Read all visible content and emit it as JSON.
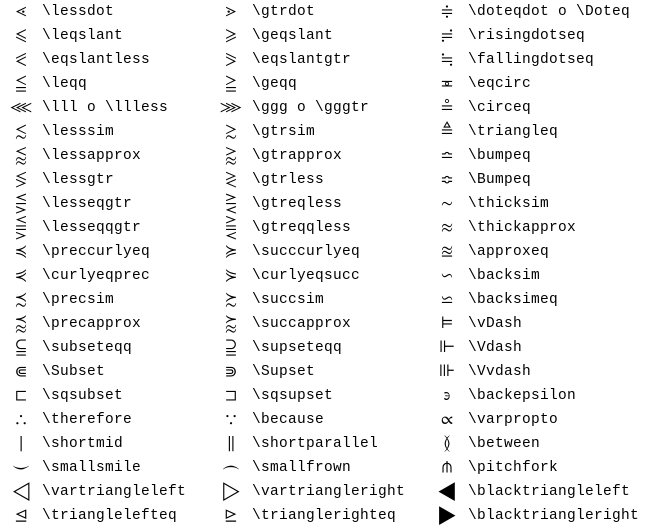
{
  "rows": [
    {
      "s1": "⋖",
      "c1": "\\lessdot",
      "s2": "⋗",
      "c2": "\\gtrdot",
      "s3": "≑",
      "c3": "\\doteqdot o \\Doteq"
    },
    {
      "s1": "⩽",
      "c1": "\\leqslant",
      "s2": "⩾",
      "c2": "\\geqslant",
      "s3": "≓",
      "c3": "\\risingdotseq"
    },
    {
      "s1": "⪕",
      "c1": "\\eqslantless",
      "s2": "⪖",
      "c2": "\\eqslantgtr",
      "s3": "≒",
      "c3": "\\fallingdotseq"
    },
    {
      "s1": "≦",
      "c1": "\\leqq",
      "s2": "≧",
      "c2": "\\geqq",
      "s3": "≖",
      "c3": "\\eqcirc"
    },
    {
      "s1": "⋘",
      "c1": "\\lll o \\llless",
      "s2": "⋙",
      "c2": "\\ggg o \\gggtr",
      "s3": "≗",
      "c3": "\\circeq"
    },
    {
      "s1": "≲",
      "c1": "\\lesssim",
      "s2": "≳",
      "c2": "\\gtrsim",
      "s3": "≜",
      "c3": "\\triangleq"
    },
    {
      "s1": "⪅",
      "c1": "\\lessapprox",
      "s2": "⪆",
      "c2": "\\gtrapprox",
      "s3": "≏",
      "c3": "\\bumpeq"
    },
    {
      "s1": "≶",
      "c1": "\\lessgtr",
      "s2": "≷",
      "c2": "\\gtrless",
      "s3": "≎",
      "c3": "\\Bumpeq"
    },
    {
      "s1": "⋚",
      "c1": "\\lesseqgtr",
      "s2": "⋛",
      "c2": "\\gtreqless",
      "s3": "∼",
      "c3": "\\thicksim"
    },
    {
      "s1": "⪋",
      "c1": "\\lesseqqgtr",
      "s2": "⪌",
      "c2": "\\gtreqqless",
      "s3": "≈",
      "c3": "\\thickapprox"
    },
    {
      "s1": "≼",
      "c1": "\\preccurlyeq",
      "s2": "≽",
      "c2": "\\succcurlyeq",
      "s3": "≊",
      "c3": "\\approxeq"
    },
    {
      "s1": "⋞",
      "c1": "\\curlyeqprec",
      "s2": "⋟",
      "c2": "\\curlyeqsucc",
      "s3": "∽",
      "c3": "\\backsim"
    },
    {
      "s1": "≾",
      "c1": "\\precsim",
      "s2": "≿",
      "c2": "\\succsim",
      "s3": "⋍",
      "c3": "\\backsimeq"
    },
    {
      "s1": "⪷",
      "c1": "\\precapprox",
      "s2": "⪸",
      "c2": "\\succapprox",
      "s3": "⊨",
      "c3": "\\vDash"
    },
    {
      "s1": "⫅",
      "c1": "\\subseteqq",
      "s2": "⫆",
      "c2": "\\supseteqq",
      "s3": "⊩",
      "c3": "\\Vdash"
    },
    {
      "s1": "⋐",
      "c1": "\\Subset",
      "s2": "⋑",
      "c2": "\\Supset",
      "s3": "⊪",
      "c3": "\\Vvdash"
    },
    {
      "s1": "⊏",
      "c1": "\\sqsubset",
      "s2": "⊐",
      "c2": "\\sqsupset",
      "s3": "϶",
      "c3": "\\backepsilon"
    },
    {
      "s1": "∴",
      "c1": "\\therefore",
      "s2": "∵",
      "c2": "\\because",
      "s3": "∝",
      "c3": "\\varpropto"
    },
    {
      "s1": "∣",
      "c1": "\\shortmid",
      "s2": "∥",
      "c2": "\\shortparallel",
      "s3": "≬",
      "c3": "\\between"
    },
    {
      "s1": "⌣",
      "c1": "\\smallsmile",
      "s2": "⌢",
      "c2": "\\smallfrown",
      "s3": "⋔",
      "c3": "\\pitchfork"
    },
    {
      "s1": "◁",
      "c1": "\\vartriangleleft",
      "s2": "▷",
      "c2": "\\vartriangleright",
      "s3": "◀",
      "c3": "\\blacktriangleleft"
    },
    {
      "s1": "⊴",
      "c1": "\\trianglelefteq",
      "s2": "⊵",
      "c2": "\\trianglerighteq",
      "s3": "▶",
      "c3": "\\blacktriangleright"
    }
  ]
}
